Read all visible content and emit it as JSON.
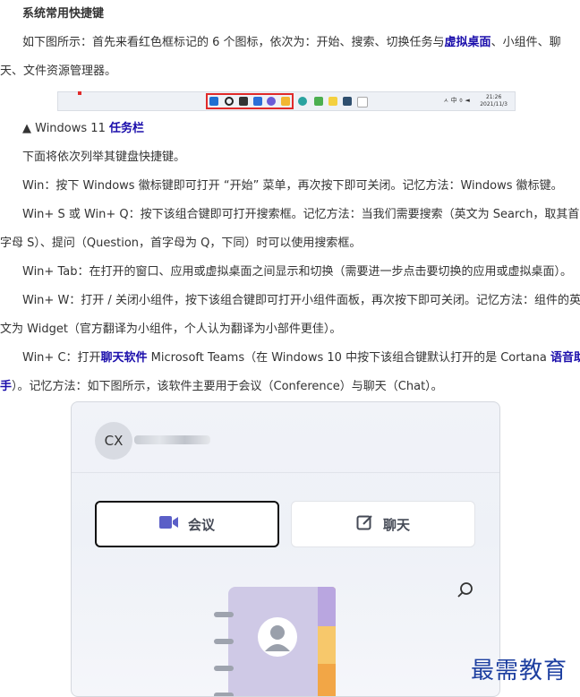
{
  "heading": "系统常用快捷键",
  "para1": {
    "line1_prefix": "如下图所示：首先来看红色框标记的 6 个图标，依次为：开始、搜索、切换任务与",
    "line1_link": "虚拟桌面",
    "line1_suffix": "、小组件、聊",
    "line2": "天、文件资源管理器。"
  },
  "taskbar": {
    "clock_time": "21:26",
    "clock_date": "2021/11/3",
    "tray_text": "ㅅ 中 ⌽ ◄",
    "accent_color": "#e02a2a"
  },
  "caption": {
    "prefix": "▲ Windows 11 ",
    "link": "任务栏"
  },
  "intro": "下面将依次列举其键盘快捷键。",
  "win": "Win：按下 Windows 徽标键即可打开 “开始” 菜单，再次按下即可关闭。记忆方法：Windows 徽标键。",
  "win_s_q": {
    "line1": "Win+ S 或 Win+ Q：按下该组合键即可打开搜索框。记忆方法：当我们需要搜索（英文为 Search，取其首",
    "line2": "字母 S）、提问（Question，首字母为 Q，下同）时可以使用搜索框。"
  },
  "win_tab": "Win+ Tab：在打开的窗口、应用或虚拟桌面之间显示和切换（需要进一步点击要切换的应用或虚拟桌面）。",
  "win_w": {
    "line1": "Win+ W：打开 / 关闭小组件，按下该组合键即可打开小组件面板，再次按下即可关闭。记忆方法：组件的英",
    "line2": "文为 Widget（官方翻译为小组件，个人认为翻译为小部件更佳）。"
  },
  "win_c": {
    "line1_prefix": "Win+ C：打开",
    "line1_link": "聊天软件",
    "line1_mid": " Microsoft Teams（在 Windows 10 中按下该组合键默认打开的是 Cortana ",
    "line1_link2": "语音助",
    "line2_link": "手",
    "line2_suffix": "）。记忆方法：如下图所示，该软件主要用于会议（Conference）与聊天（Chat）。"
  },
  "teams_panel": {
    "avatar_initials": "CX",
    "meet_label": "会议",
    "chat_label": "聊天"
  },
  "watermark": "最需教育",
  "colors": {
    "link": "#1a0dab",
    "text": "#333333",
    "meet_icon": "#5b5fc7"
  }
}
